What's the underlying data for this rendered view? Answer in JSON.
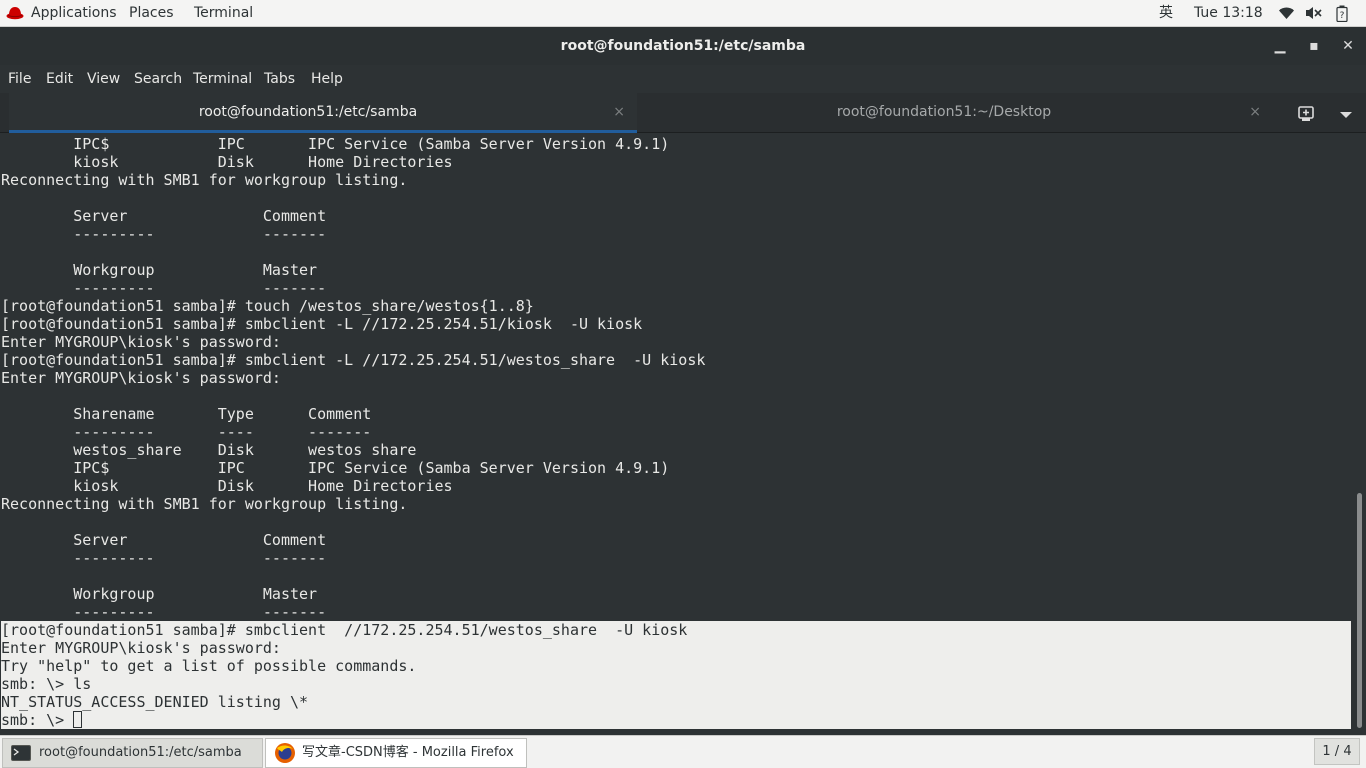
{
  "top_panel": {
    "applications": "Applications",
    "places": "Places",
    "terminal": "Terminal",
    "input_method": "英",
    "clock": "Tue 13:18",
    "icons": [
      "wifi-icon",
      "volume-muted-icon",
      "battery-icon"
    ]
  },
  "window": {
    "title": "root@foundation51:/etc/samba",
    "minimize": "▁",
    "maximize": "▪",
    "close": "✕"
  },
  "menubar": [
    "File",
    "Edit",
    "View",
    "Search",
    "Terminal",
    "Tabs",
    "Help"
  ],
  "tabs": [
    {
      "label": "root@foundation51:/etc/samba",
      "close": "×",
      "active": true
    },
    {
      "label": "root@foundation51:~/Desktop",
      "close": "×",
      "active": false
    }
  ],
  "tab_buttons": {
    "new_tab": "⊞",
    "menu": "▼"
  },
  "terminal": {
    "lines": [
      "        IPC$            IPC       IPC Service (Samba Server Version 4.9.1)",
      "        kiosk           Disk      Home Directories",
      "Reconnecting with SMB1 for workgroup listing.",
      "",
      "        Server               Comment",
      "        ---------            -------",
      "",
      "        Workgroup            Master",
      "        ---------            -------",
      "[root@foundation51 samba]# touch /westos_share/westos{1..8}",
      "[root@foundation51 samba]# smbclient -L //172.25.254.51/kiosk  -U kiosk",
      "Enter MYGROUP\\kiosk's password:",
      "[root@foundation51 samba]# smbclient -L //172.25.254.51/westos_share  -U kiosk",
      "Enter MYGROUP\\kiosk's password:",
      "",
      "        Sharename       Type      Comment",
      "        ---------       ----      -------",
      "        westos_share    Disk      westos share",
      "        IPC$            IPC       IPC Service (Samba Server Version 4.9.1)",
      "        kiosk           Disk      Home Directories",
      "Reconnecting with SMB1 for workgroup listing.",
      "",
      "        Server               Comment",
      "        ---------            -------",
      "",
      "        Workgroup            Master",
      "        ---------            -------"
    ],
    "highlighted_lines": [
      "[root@foundation51 samba]# smbclient  //172.25.254.51/westos_share  -U kiosk",
      "Enter MYGROUP\\kiosk's password:",
      "Try \"help\" to get a list of possible commands.",
      "smb: \\> ls",
      "NT_STATUS_ACCESS_DENIED listing \\*",
      "smb: \\> "
    ]
  },
  "taskbar": {
    "tasks": [
      {
        "label": "root@foundation51:/etc/samba",
        "icon": "terminal-icon",
        "active": true
      },
      {
        "label": "写文章-CSDN博客 - Mozilla Firefox",
        "icon": "firefox-icon",
        "active": false
      }
    ],
    "workspace": "1 / 4"
  }
}
